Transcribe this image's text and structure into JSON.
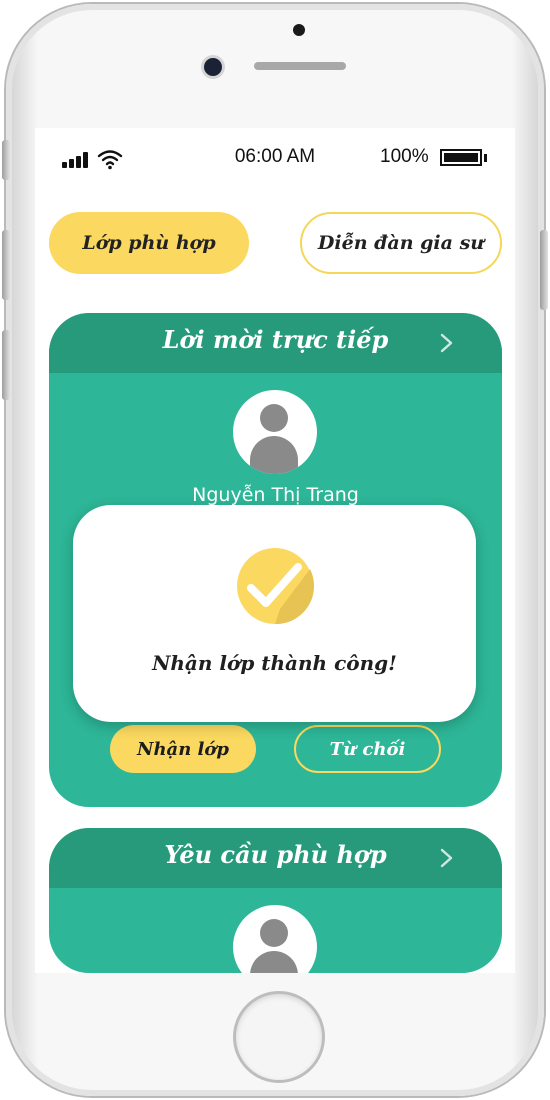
{
  "status_bar": {
    "time": "06:00 AM",
    "battery": "100%"
  },
  "tabs": {
    "active": "Lớp phù hợp",
    "other": "Diễn đàn gia sư"
  },
  "invite_card": {
    "title": "Lời mời trực tiếp",
    "name": "Nguyễn Thị Trang",
    "accept_label": "Nhận lớp",
    "reject_label": "Từ chối"
  },
  "match_card": {
    "title": "Yêu cầu phù hợp"
  },
  "dialog": {
    "message": "Nhận lớp thành công!"
  },
  "colors": {
    "accent": "#fbd960",
    "card": "#2db697",
    "card_header": "#289a7c"
  },
  "icons": [
    "signal-icon",
    "wifi-icon",
    "battery-icon",
    "chevron-right-icon",
    "avatar-icon",
    "check-circle-icon"
  ]
}
